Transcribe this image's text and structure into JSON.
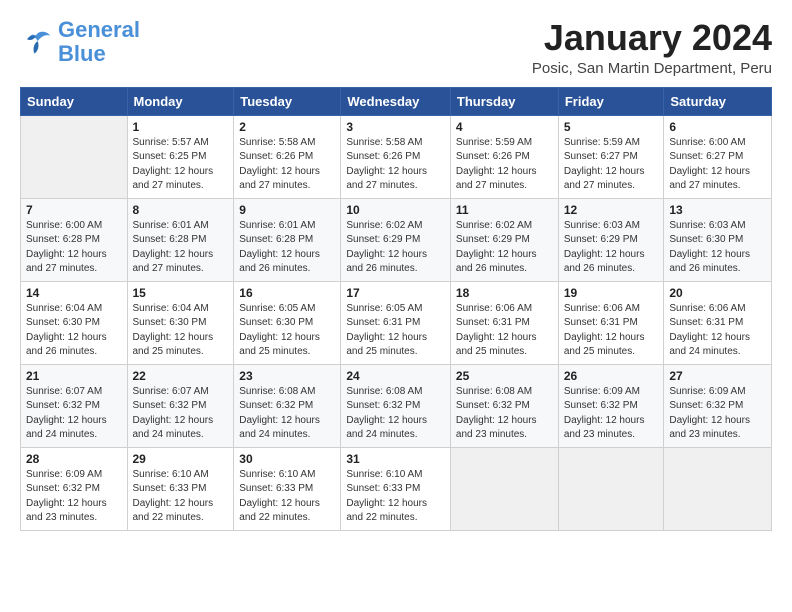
{
  "logo": {
    "line1": "General",
    "line2": "Blue"
  },
  "title": "January 2024",
  "subtitle": "Posic, San Martin Department, Peru",
  "header": {
    "days": [
      "Sunday",
      "Monday",
      "Tuesday",
      "Wednesday",
      "Thursday",
      "Friday",
      "Saturday"
    ]
  },
  "weeks": [
    [
      {
        "num": "",
        "info": ""
      },
      {
        "num": "1",
        "info": "Sunrise: 5:57 AM\nSunset: 6:25 PM\nDaylight: 12 hours\nand 27 minutes."
      },
      {
        "num": "2",
        "info": "Sunrise: 5:58 AM\nSunset: 6:26 PM\nDaylight: 12 hours\nand 27 minutes."
      },
      {
        "num": "3",
        "info": "Sunrise: 5:58 AM\nSunset: 6:26 PM\nDaylight: 12 hours\nand 27 minutes."
      },
      {
        "num": "4",
        "info": "Sunrise: 5:59 AM\nSunset: 6:26 PM\nDaylight: 12 hours\nand 27 minutes."
      },
      {
        "num": "5",
        "info": "Sunrise: 5:59 AM\nSunset: 6:27 PM\nDaylight: 12 hours\nand 27 minutes."
      },
      {
        "num": "6",
        "info": "Sunrise: 6:00 AM\nSunset: 6:27 PM\nDaylight: 12 hours\nand 27 minutes."
      }
    ],
    [
      {
        "num": "7",
        "info": "Sunrise: 6:00 AM\nSunset: 6:28 PM\nDaylight: 12 hours\nand 27 minutes."
      },
      {
        "num": "8",
        "info": "Sunrise: 6:01 AM\nSunset: 6:28 PM\nDaylight: 12 hours\nand 27 minutes."
      },
      {
        "num": "9",
        "info": "Sunrise: 6:01 AM\nSunset: 6:28 PM\nDaylight: 12 hours\nand 26 minutes."
      },
      {
        "num": "10",
        "info": "Sunrise: 6:02 AM\nSunset: 6:29 PM\nDaylight: 12 hours\nand 26 minutes."
      },
      {
        "num": "11",
        "info": "Sunrise: 6:02 AM\nSunset: 6:29 PM\nDaylight: 12 hours\nand 26 minutes."
      },
      {
        "num": "12",
        "info": "Sunrise: 6:03 AM\nSunset: 6:29 PM\nDaylight: 12 hours\nand 26 minutes."
      },
      {
        "num": "13",
        "info": "Sunrise: 6:03 AM\nSunset: 6:30 PM\nDaylight: 12 hours\nand 26 minutes."
      }
    ],
    [
      {
        "num": "14",
        "info": "Sunrise: 6:04 AM\nSunset: 6:30 PM\nDaylight: 12 hours\nand 26 minutes."
      },
      {
        "num": "15",
        "info": "Sunrise: 6:04 AM\nSunset: 6:30 PM\nDaylight: 12 hours\nand 25 minutes."
      },
      {
        "num": "16",
        "info": "Sunrise: 6:05 AM\nSunset: 6:30 PM\nDaylight: 12 hours\nand 25 minutes."
      },
      {
        "num": "17",
        "info": "Sunrise: 6:05 AM\nSunset: 6:31 PM\nDaylight: 12 hours\nand 25 minutes."
      },
      {
        "num": "18",
        "info": "Sunrise: 6:06 AM\nSunset: 6:31 PM\nDaylight: 12 hours\nand 25 minutes."
      },
      {
        "num": "19",
        "info": "Sunrise: 6:06 AM\nSunset: 6:31 PM\nDaylight: 12 hours\nand 25 minutes."
      },
      {
        "num": "20",
        "info": "Sunrise: 6:06 AM\nSunset: 6:31 PM\nDaylight: 12 hours\nand 24 minutes."
      }
    ],
    [
      {
        "num": "21",
        "info": "Sunrise: 6:07 AM\nSunset: 6:32 PM\nDaylight: 12 hours\nand 24 minutes."
      },
      {
        "num": "22",
        "info": "Sunrise: 6:07 AM\nSunset: 6:32 PM\nDaylight: 12 hours\nand 24 minutes."
      },
      {
        "num": "23",
        "info": "Sunrise: 6:08 AM\nSunset: 6:32 PM\nDaylight: 12 hours\nand 24 minutes."
      },
      {
        "num": "24",
        "info": "Sunrise: 6:08 AM\nSunset: 6:32 PM\nDaylight: 12 hours\nand 24 minutes."
      },
      {
        "num": "25",
        "info": "Sunrise: 6:08 AM\nSunset: 6:32 PM\nDaylight: 12 hours\nand 23 minutes."
      },
      {
        "num": "26",
        "info": "Sunrise: 6:09 AM\nSunset: 6:32 PM\nDaylight: 12 hours\nand 23 minutes."
      },
      {
        "num": "27",
        "info": "Sunrise: 6:09 AM\nSunset: 6:32 PM\nDaylight: 12 hours\nand 23 minutes."
      }
    ],
    [
      {
        "num": "28",
        "info": "Sunrise: 6:09 AM\nSunset: 6:32 PM\nDaylight: 12 hours\nand 23 minutes."
      },
      {
        "num": "29",
        "info": "Sunrise: 6:10 AM\nSunset: 6:33 PM\nDaylight: 12 hours\nand 22 minutes."
      },
      {
        "num": "30",
        "info": "Sunrise: 6:10 AM\nSunset: 6:33 PM\nDaylight: 12 hours\nand 22 minutes."
      },
      {
        "num": "31",
        "info": "Sunrise: 6:10 AM\nSunset: 6:33 PM\nDaylight: 12 hours\nand 22 minutes."
      },
      {
        "num": "",
        "info": ""
      },
      {
        "num": "",
        "info": ""
      },
      {
        "num": "",
        "info": ""
      }
    ]
  ]
}
